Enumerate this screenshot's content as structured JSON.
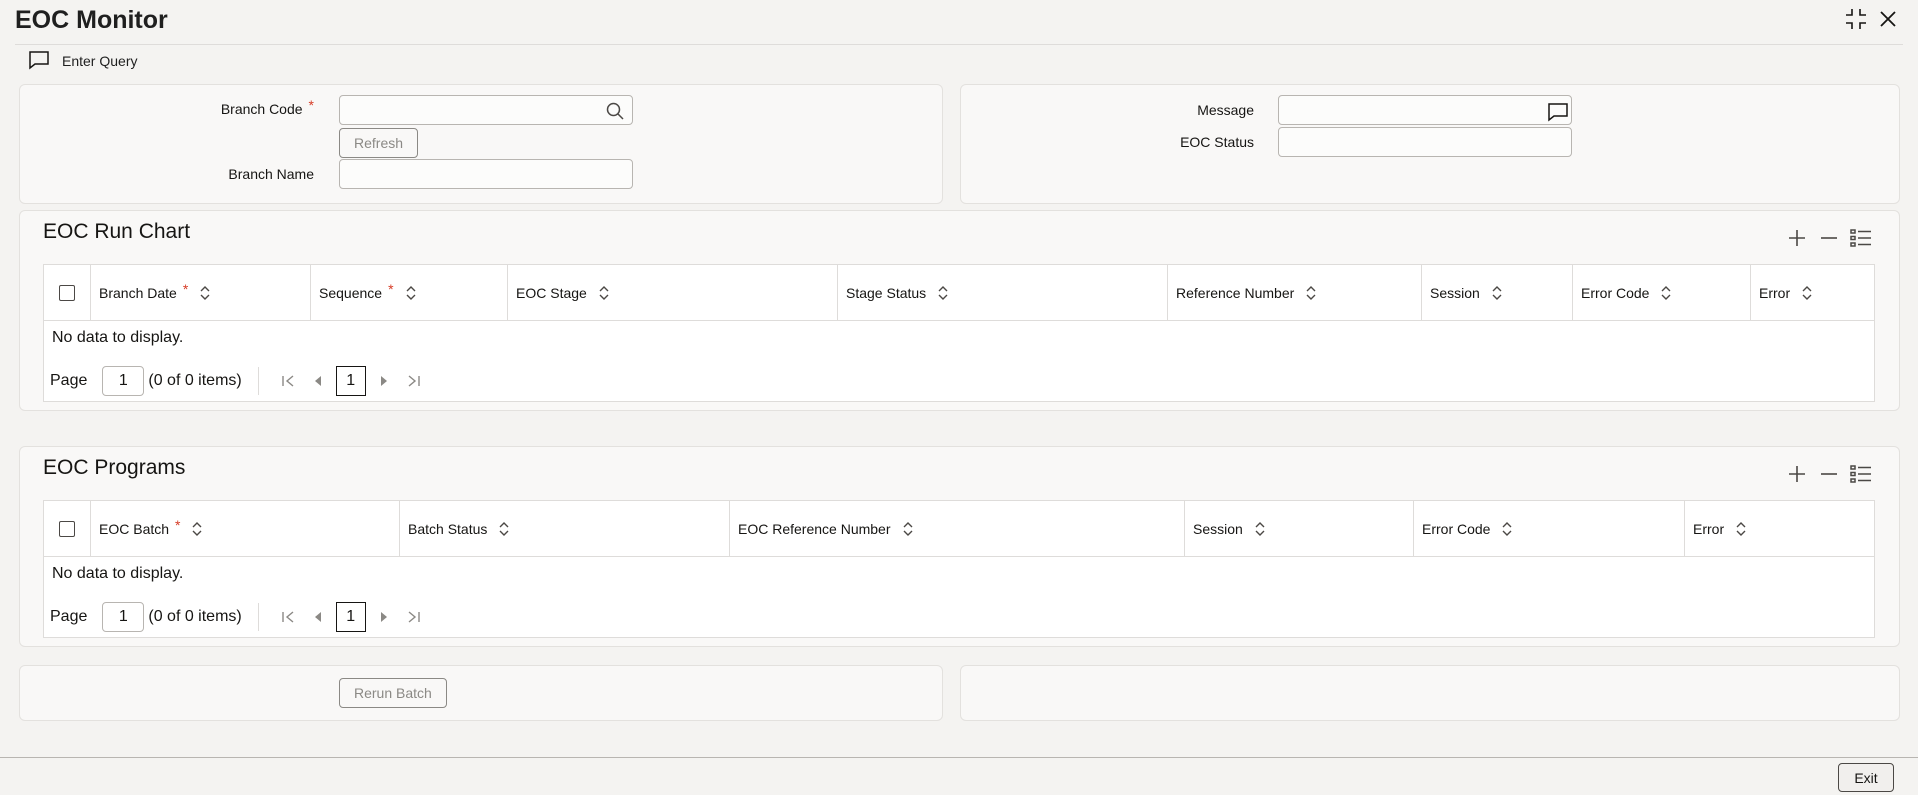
{
  "window": {
    "title": "EOC Monitor"
  },
  "toolbar": {
    "enter_query": "Enter Query"
  },
  "header_form": {
    "branch_code_label": "Branch Code",
    "branch_code_value": "",
    "refresh_label": "Refresh",
    "branch_name_label": "Branch Name",
    "branch_name_value": "",
    "message_label": "Message",
    "message_value": "",
    "eoc_status_label": "EOC Status",
    "eoc_status_value": "",
    "required_mark": "*"
  },
  "run_chart": {
    "title": "EOC Run Chart",
    "columns": [
      "Branch Date",
      "Sequence",
      "EOC Stage",
      "Stage Status",
      "Reference Number",
      "Session",
      "Error Code",
      "Error"
    ],
    "empty_text": "No data to display.",
    "pager": {
      "page_label": "Page",
      "page_value": "1",
      "count_text": "(0 of 0 items)",
      "current_page": "1"
    }
  },
  "programs": {
    "title": "EOC Programs",
    "columns": [
      "EOC Batch",
      "Batch Status",
      "EOC Reference Number",
      "Session",
      "Error Code",
      "Error"
    ],
    "empty_text": "No data to display.",
    "pager": {
      "page_label": "Page",
      "page_value": "1",
      "count_text": "(0 of 0 items)",
      "current_page": "1"
    }
  },
  "footer": {
    "rerun_batch_label": "Rerun Batch",
    "exit_label": "Exit"
  },
  "colors": {
    "required": "#d63b25",
    "disabled_text": "#8b8985",
    "border": "#dedcda"
  }
}
